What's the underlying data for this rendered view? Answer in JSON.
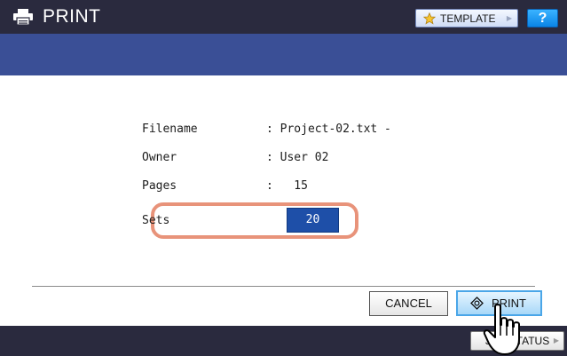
{
  "header": {
    "title": "PRINT",
    "title_icon": "printer-icon",
    "template_label": "TEMPLATE",
    "template_icon": "star-icon",
    "help_label": "?"
  },
  "job_info": {
    "rows": [
      {
        "label": "Filename",
        "value": ": Project-02.txt -"
      },
      {
        "label": "Owner",
        "value": ": User 02"
      },
      {
        "label": "Pages",
        "value": ":   15"
      }
    ],
    "sets": {
      "label": "Sets",
      "value": "20"
    }
  },
  "actions": {
    "cancel_label": "CANCEL",
    "print_label": "PRINT",
    "print_icon": "start-diamond-icon"
  },
  "footer": {
    "job_status_label": "JOB STATUS"
  },
  "overlay": {
    "cursor_icon": "hand-pointer-icon"
  },
  "colors": {
    "titlebar": "#2a2a3e",
    "bluebar": "#3a4f96",
    "sets_value_bg": "#1e4fa8",
    "highlight_outline": "#e8937a",
    "print_button_border": "#4aa6e8"
  }
}
